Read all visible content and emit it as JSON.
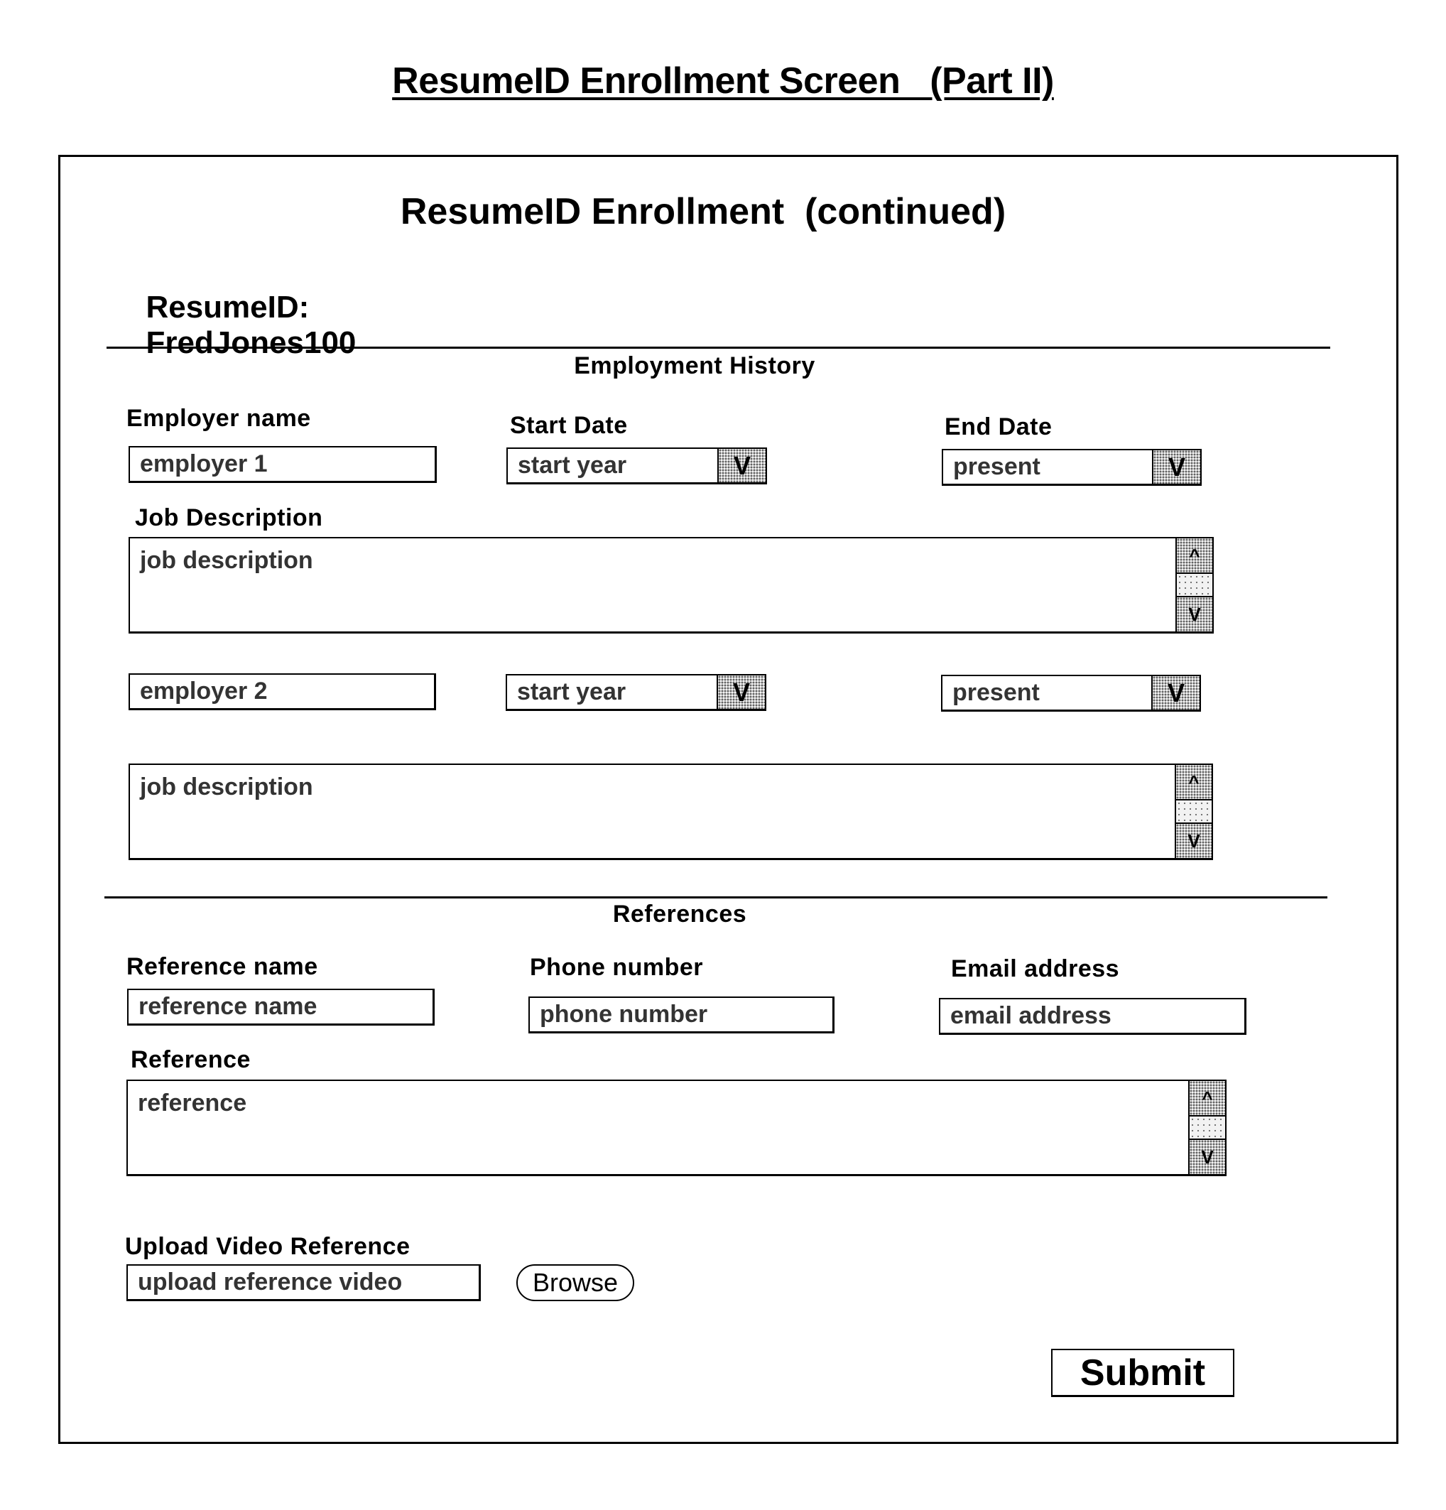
{
  "page_title": "ResumeID Enrollment Screen   (Part II)",
  "form": {
    "heading": "ResumeID Enrollment  (continued)",
    "resume_id_label": "ResumeID:",
    "resume_id_value": "FredJones100"
  },
  "employment": {
    "section_title": "Employment History",
    "labels": {
      "employer_name": "Employer name",
      "start_date": "Start Date",
      "end_date": "End Date",
      "job_description": "Job Description"
    },
    "entries": [
      {
        "employer": "employer 1",
        "start": "start year",
        "end": "present",
        "description": "job description"
      },
      {
        "employer": "employer 2",
        "start": "start year",
        "end": "present",
        "description": "job description"
      }
    ],
    "dropdown_glyph": "V",
    "dropdown_icon": "chevron-down-icon"
  },
  "scrollbar": {
    "up_glyph": "^",
    "down_glyph": "V"
  },
  "references": {
    "section_title": "References",
    "labels": {
      "name": "Reference name",
      "phone": "Phone number",
      "email": "Email address",
      "reference": "Reference"
    },
    "placeholders": {
      "name": "reference name",
      "phone": "phone number",
      "email": "email address",
      "reference": "reference"
    }
  },
  "upload": {
    "label": "Upload Video Reference",
    "placeholder": "upload reference video",
    "browse_label": "Browse"
  },
  "actions": {
    "submit_label": "Submit"
  }
}
